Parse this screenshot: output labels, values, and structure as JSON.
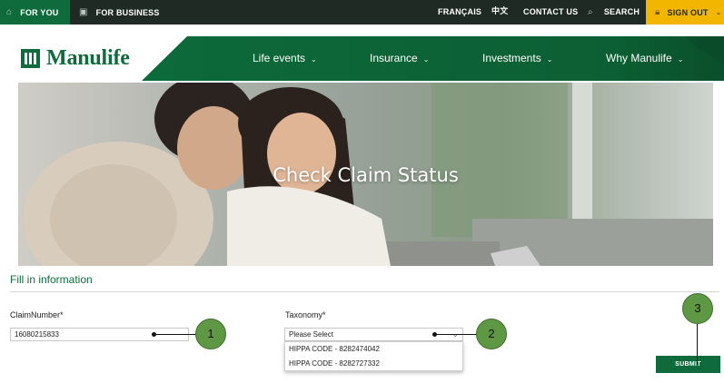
{
  "topbar": {
    "for_you": "FOR YOU",
    "for_business": "FOR BUSINESS",
    "francais": "FRANÇAIS",
    "chinese": "中文",
    "contact": "CONTACT US",
    "search": "SEARCH",
    "sign_out": "SIGN OUT",
    "icons": {
      "home": "home-icon",
      "business": "briefcase-icon",
      "search": "search-icon",
      "lock": "lock-icon"
    }
  },
  "brand": {
    "name": "Manulife"
  },
  "nav": {
    "items": [
      "Life events",
      "Insurance",
      "Investments",
      "Why Manulife"
    ]
  },
  "hero": {
    "title": "Check Claim Status"
  },
  "form": {
    "section_title": "Fill in information",
    "claim_label": "ClaimNumber*",
    "claim_value": "16080215833",
    "taxonomy_label": "Taxonomy*",
    "taxonomy_selected": "Please Select",
    "taxonomy_options": [
      "HIPPA CODE - 8282474042",
      "HIPPA CODE - 8282727332"
    ],
    "submit_label": "SUBMIT"
  },
  "annotations": [
    "1",
    "2",
    "3"
  ],
  "colors": {
    "brand_green": "#0f6b3c",
    "topbar_dark": "#1f2a24",
    "signout_yellow": "#f3b600",
    "callout_green": "#5f9845"
  }
}
